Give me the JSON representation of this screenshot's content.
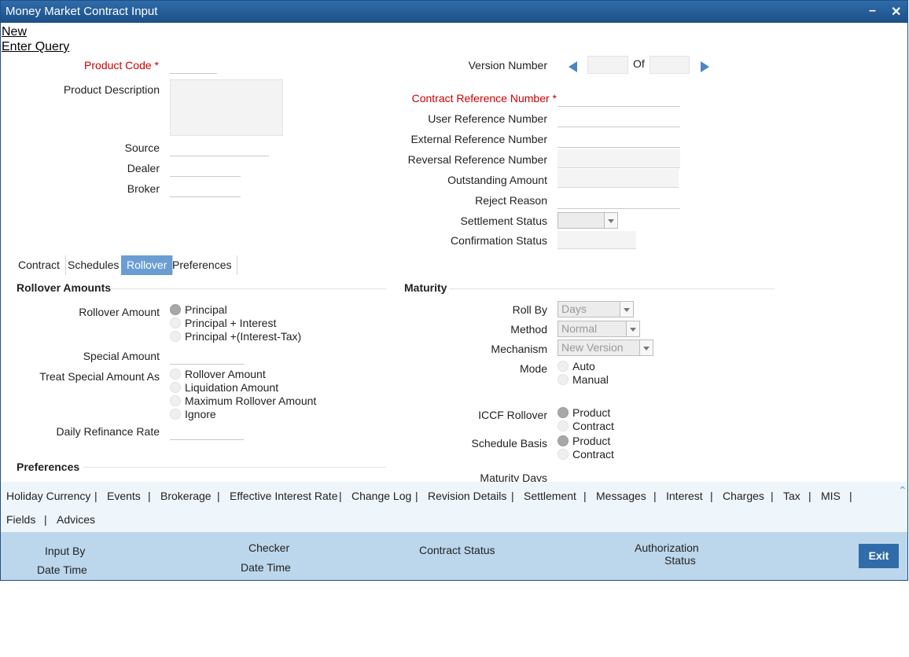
{
  "window": {
    "title": "Money Market Contract Input"
  },
  "menu": {
    "new_label": "New",
    "enter_query_label": "Enter Query"
  },
  "header": {
    "product_code_label": "Product Code",
    "product_description_label": "Product Description",
    "source_label": "Source",
    "dealer_label": "Dealer",
    "broker_label": "Broker",
    "version_number_label": "Version Number",
    "of_label": "Of",
    "contract_ref_label": "Contract Reference Number",
    "user_ref_label": "User Reference Number",
    "external_ref_label": "External Reference Number",
    "reversal_ref_label": "Reversal Reference Number",
    "outstanding_amount_label": "Outstanding Amount",
    "reject_reason_label": "Reject Reason",
    "settlement_status_label": "Settlement Status",
    "confirmation_status_label": "Confirmation Status",
    "required_mark": "*"
  },
  "tabs": [
    {
      "label": "Contract"
    },
    {
      "label": "Schedules"
    },
    {
      "label": "Rollover"
    },
    {
      "label": "Preferences"
    }
  ],
  "rollover": {
    "section_title": "Rollover Amounts",
    "rollover_amount_label": "Rollover Amount",
    "rollover_amount_options": [
      "Principal",
      "Principal + Interest",
      "Principal +(Interest-Tax)"
    ],
    "special_amount_label": "Special Amount",
    "treat_special_label": "Treat Special Amount As",
    "treat_special_options": [
      "Rollover Amount",
      "Liquidation Amount",
      "Maximum Rollover Amount",
      "Ignore"
    ],
    "daily_refinance_label": "Daily Refinance Rate",
    "preferences_title": "Preferences"
  },
  "maturity": {
    "section_title": "Maturity",
    "roll_by_label": "Roll By",
    "roll_by_value": "Days",
    "method_label": "Method",
    "method_value": "Normal",
    "mechanism_label": "Mechanism",
    "mechanism_value": "New Version",
    "mode_label": "Mode",
    "mode_options": [
      "Auto",
      "Manual"
    ],
    "iccf_label": "ICCF Rollover",
    "iccf_options": [
      "Product",
      "Contract"
    ],
    "schedule_basis_label": "Schedule Basis",
    "schedule_basis_options": [
      "Product",
      "Contract"
    ],
    "maturity_days_label": "Maturity Days"
  },
  "subsystems": {
    "row1": [
      "Holiday Currency",
      "Events",
      "Brokerage",
      "Effective Interest Rate",
      "Change Log",
      "Revision Details",
      "Settlement",
      "Messages",
      "Interest",
      "Charges",
      "Tax",
      "MIS"
    ],
    "row2": [
      "Fields",
      "Advices"
    ],
    "separator": "|"
  },
  "footer": {
    "input_by": "Input By",
    "date_time": "Date Time",
    "checker": "Checker",
    "contract_status": "Contract Status",
    "authorization": "Authorization",
    "status": "Status",
    "exit_label": "Exit"
  },
  "icons": {
    "minimize": "minimize-icon",
    "close": "close-icon",
    "prev": "triangle-left-icon",
    "next": "triangle-right-icon",
    "scroll_up": "chevron-up-icon"
  },
  "colors": {
    "titlebar": "#1c4f88",
    "tab_active": "#6a9ed3",
    "required": "#cc0000",
    "footer": "#bcd7ec",
    "exit_button": "#2f6ca9"
  }
}
